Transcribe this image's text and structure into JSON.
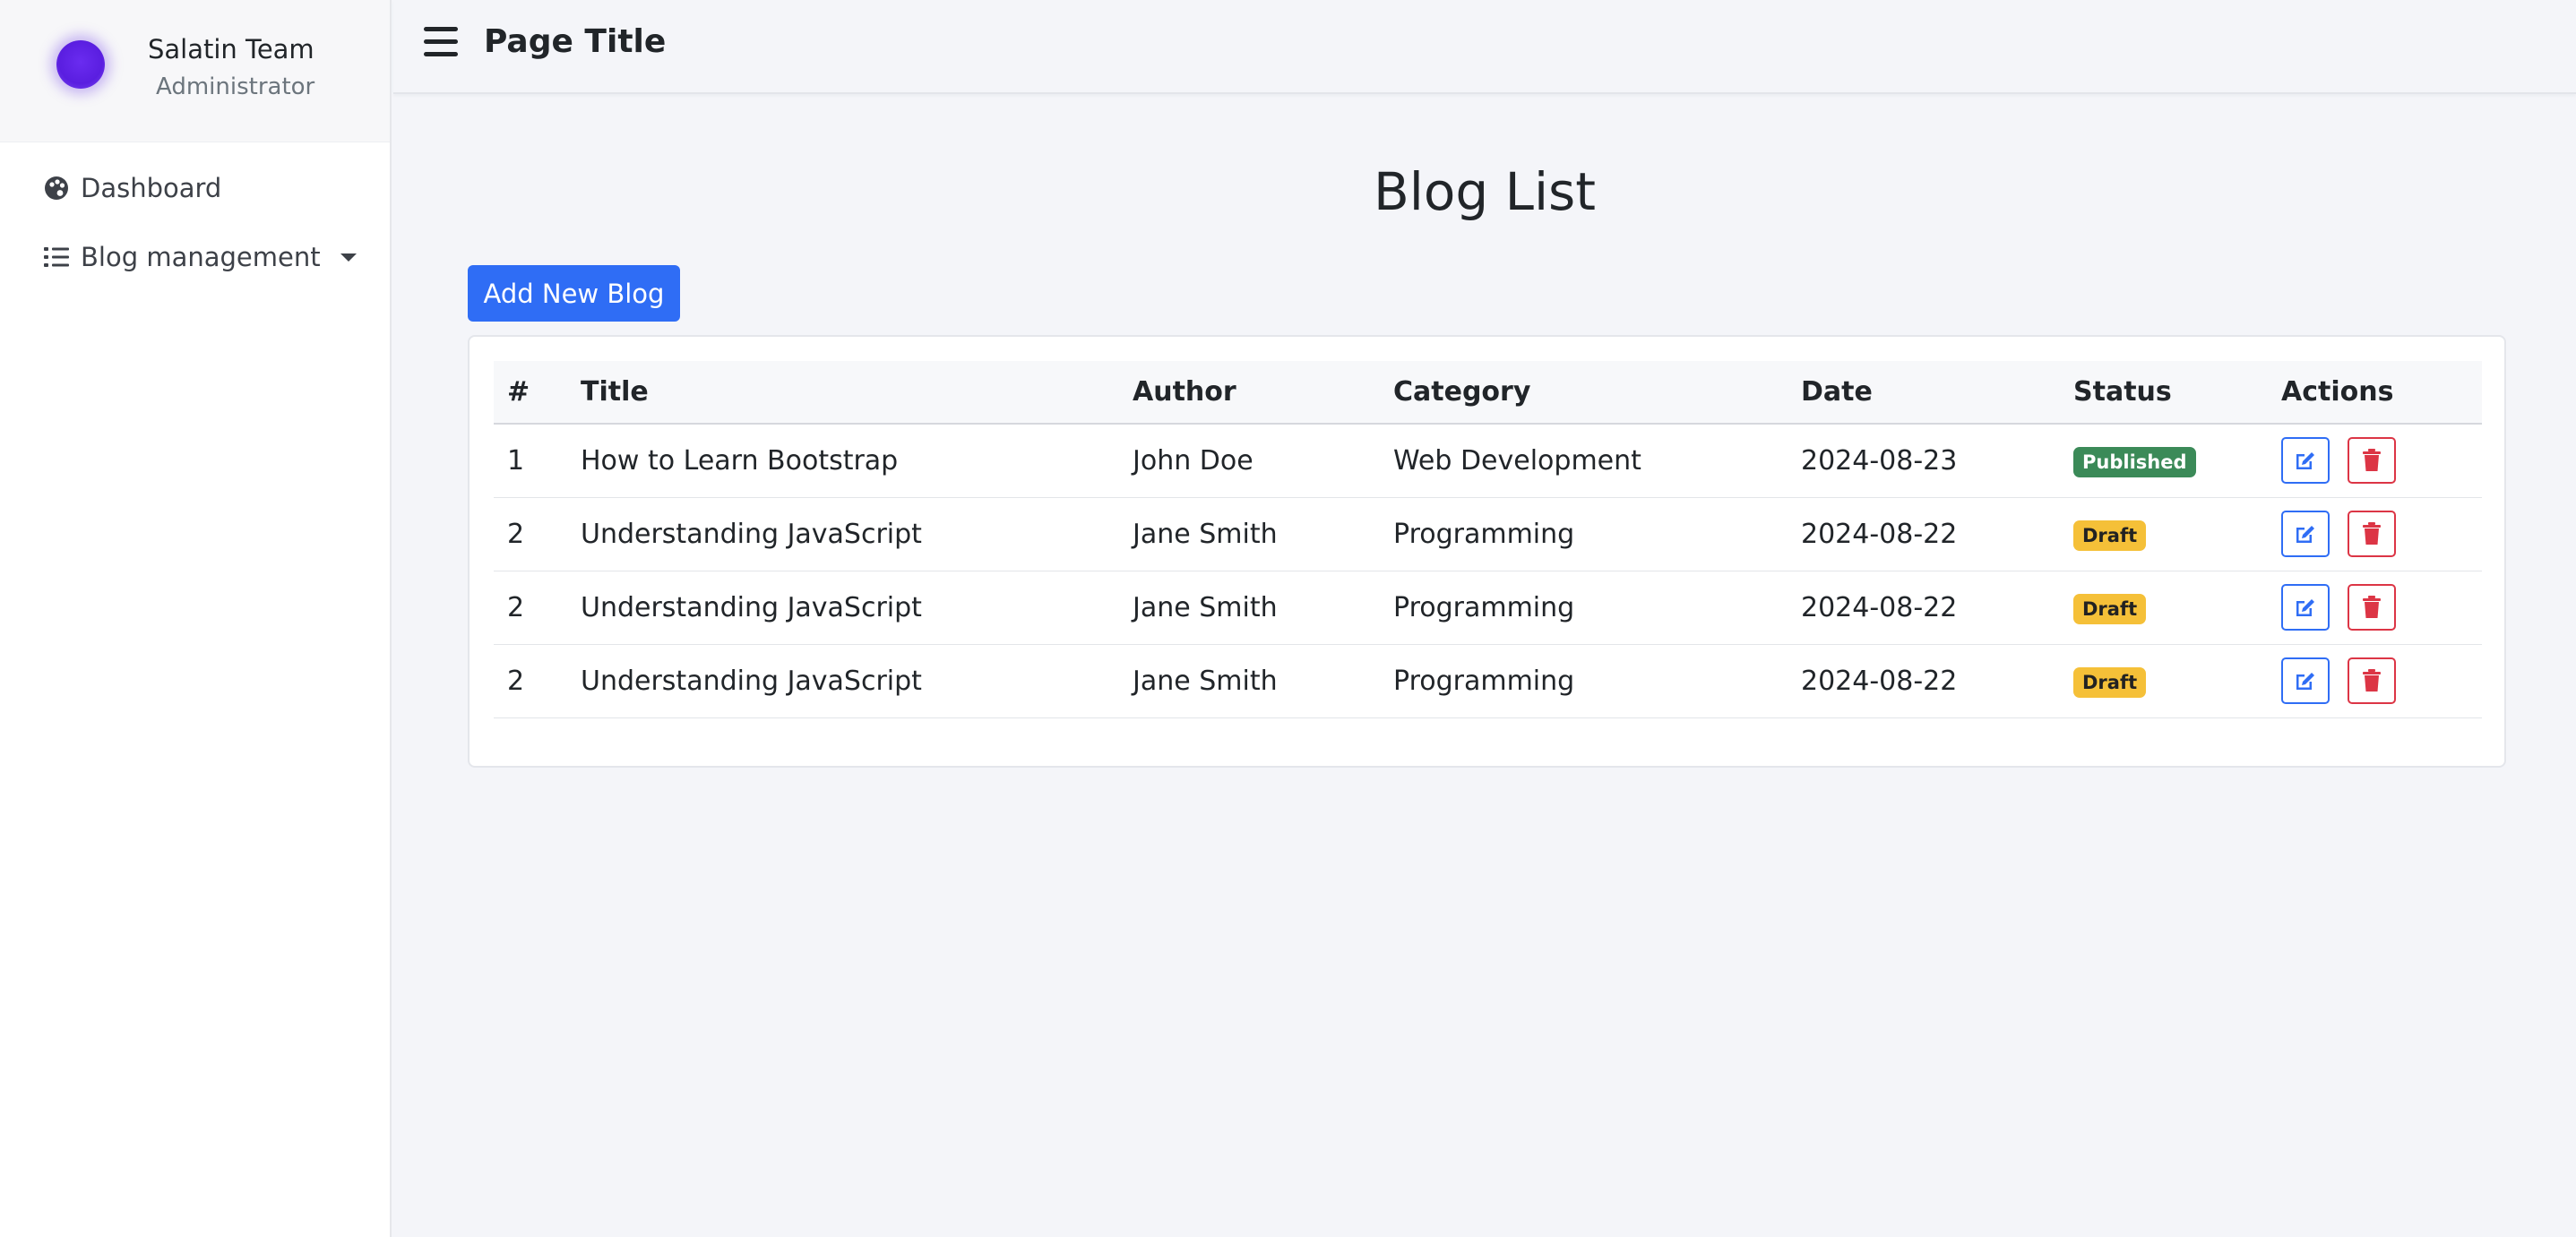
{
  "sidebar": {
    "profile": {
      "name": "Salatin Team",
      "role": "Administrator"
    },
    "items": [
      {
        "label": "Dashboard",
        "icon": "palette-icon"
      },
      {
        "label": "Blog management",
        "icon": "list-icon",
        "has_dropdown": true
      }
    ]
  },
  "header": {
    "title": "Page Title"
  },
  "main": {
    "heading": "Blog List",
    "add_button_label": "Add New Blog",
    "table": {
      "columns": [
        "#",
        "Title",
        "Author",
        "Category",
        "Date",
        "Status",
        "Actions"
      ],
      "rows": [
        {
          "num": "1",
          "title": "How to Learn Bootstrap",
          "author": "John Doe",
          "category": "Web Development",
          "date": "2024-08-23",
          "status": "Published"
        },
        {
          "num": "2",
          "title": "Understanding JavaScript",
          "author": "Jane Smith",
          "category": "Programming",
          "date": "2024-08-22",
          "status": "Draft"
        },
        {
          "num": "2",
          "title": "Understanding JavaScript",
          "author": "Jane Smith",
          "category": "Programming",
          "date": "2024-08-22",
          "status": "Draft"
        },
        {
          "num": "2",
          "title": "Understanding JavaScript",
          "author": "Jane Smith",
          "category": "Programming",
          "date": "2024-08-22",
          "status": "Draft"
        }
      ]
    }
  },
  "colors": {
    "primary": "#2f6df5",
    "danger": "#dc3545",
    "published": "#3b8a58",
    "draft": "#f5c038",
    "avatar": "#5a1ee0"
  }
}
